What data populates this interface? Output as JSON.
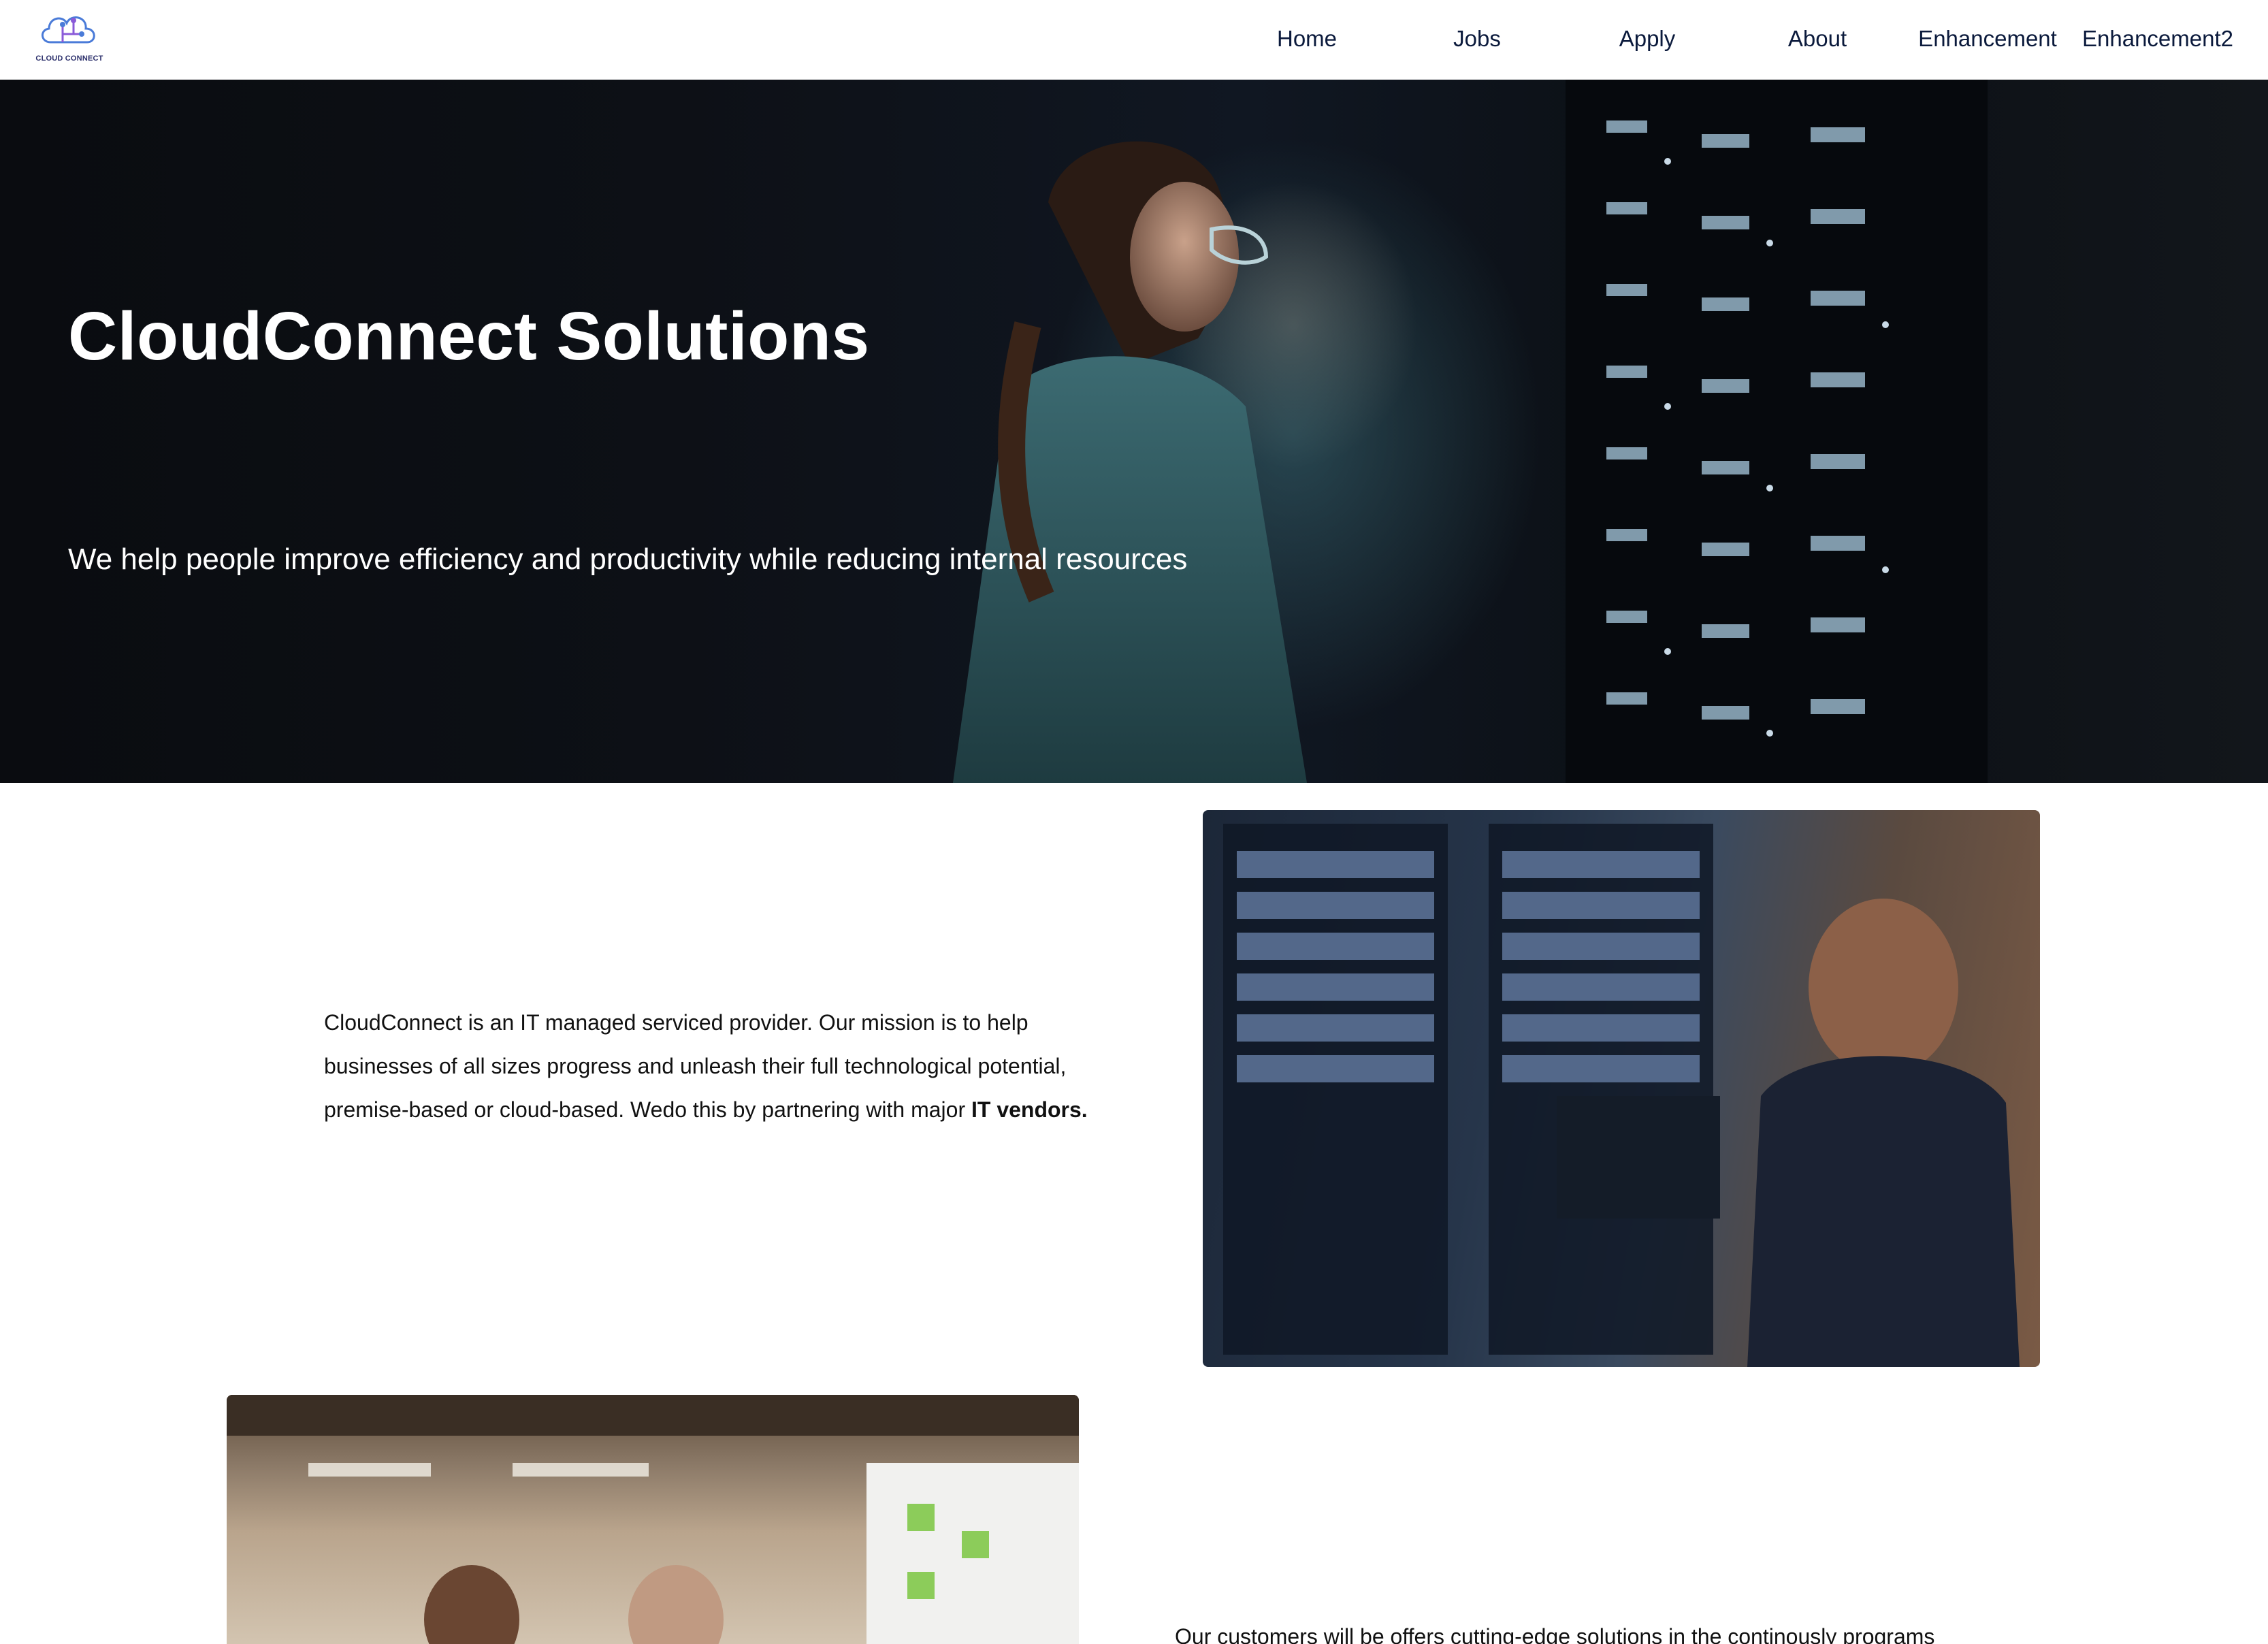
{
  "header": {
    "logo_text": "CLOUD CONNECT",
    "nav": [
      {
        "label": "Home"
      },
      {
        "label": "Jobs"
      },
      {
        "label": "Apply"
      },
      {
        "label": "About"
      },
      {
        "label": "Enhancement"
      },
      {
        "label": "Enhancement2"
      }
    ]
  },
  "hero": {
    "title": "CloudConnect Solutions",
    "subtitle": "We help people improve efficiency and productivity while reducing internal resources"
  },
  "about": {
    "text_main": "CloudConnect is an IT managed serviced provider. Our mission is to help businesses of all sizes progress and unleash their full technological potential, premise-based or cloud-based. Wedo this by partnering with major ",
    "text_bold": "IT vendors."
  },
  "customers": {
    "text": "Our customers will be offers cutting-edge solutions in the continously programs"
  },
  "colors": {
    "nav_text": "#0b1a3c",
    "logo_blue": "#4a7bd8",
    "logo_purple": "#8a5ad8"
  }
}
